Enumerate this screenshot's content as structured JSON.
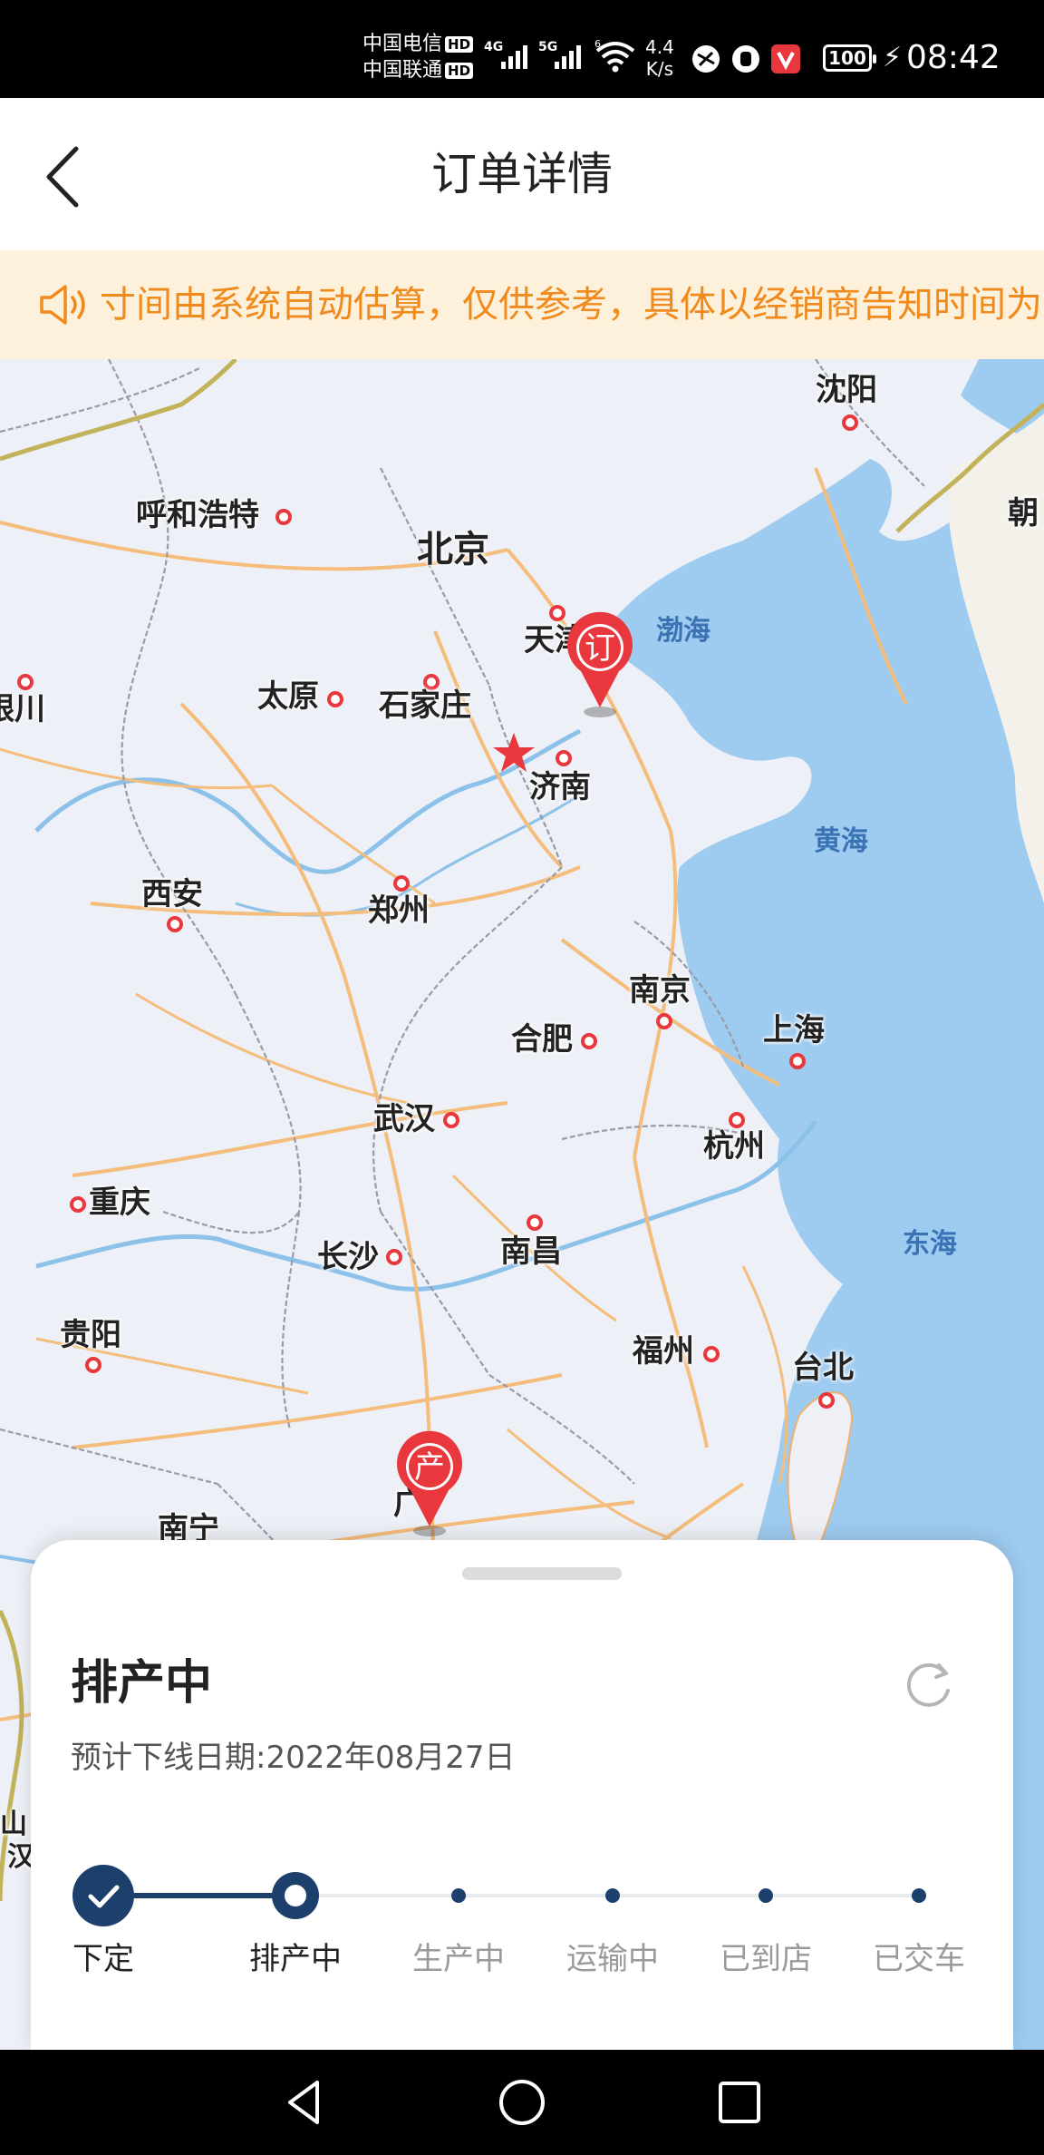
{
  "status_bar": {
    "carrier1": "中国电信",
    "carrier2": "中国联通",
    "hd": "HD",
    "net1": "4G",
    "net2": "5G",
    "wifi_gen": "6",
    "speed_value": "4.4",
    "speed_unit": "K/s",
    "battery": "100",
    "time": "08:42"
  },
  "header": {
    "title": "订单详情"
  },
  "notice": {
    "text": "寸间由系统自动估算，仅供参考，具体以经销商告知时间为准"
  },
  "map": {
    "cities": [
      "沈阳",
      "呼和浩特",
      "北京",
      "天津",
      "太原",
      "石家庄",
      "银川",
      "济南",
      "西安",
      "郑州",
      "南京",
      "合肥",
      "上海",
      "武汉",
      "杭州",
      "重庆",
      "长沙",
      "南昌",
      "贵阳",
      "福州",
      "台北",
      "南宁",
      "广州"
    ],
    "label_trunc": {
      "yinchuan": "银川",
      "tianjin": "天津",
      "guangzhou": "广",
      "nanning": "南宁",
      "korea": "朝",
      "left1": "山",
      "left2": "汉"
    },
    "seas": [
      "渤海",
      "黄海",
      "东海"
    ],
    "order_marker": "订",
    "factory_marker": "产"
  },
  "order_status": {
    "title": "排产中",
    "estimated_date": "预计下线日期:2022年08月27日",
    "steps": [
      {
        "label": "下定",
        "state": "done"
      },
      {
        "label": "排产中",
        "state": "current"
      },
      {
        "label": "生产中",
        "state": "pending"
      },
      {
        "label": "运输中",
        "state": "pending"
      },
      {
        "label": "已到店",
        "state": "pending"
      },
      {
        "label": "已交车",
        "state": "pending"
      }
    ]
  },
  "colors": {
    "accent": "#1d3f6b",
    "notice_text": "#f08a1c",
    "notice_bg": "#fdf1dc",
    "marker_red": "#e8383d",
    "water": "#9ecbf0",
    "pending_text": "#9a9a9a"
  }
}
